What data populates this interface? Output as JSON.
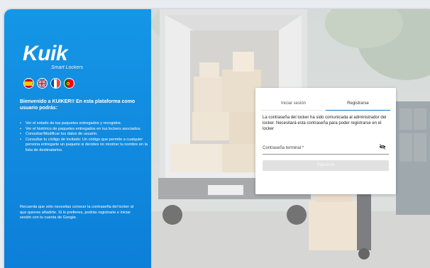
{
  "brand": {
    "name": "Kuik",
    "tagline": "Smart Lockers"
  },
  "languages": [
    {
      "name": "es-flag-icon",
      "colors": [
        "#c60b1e",
        "#ffc400",
        "#c60b1e"
      ]
    },
    {
      "name": "uk-flag-icon",
      "colors": [
        "#012169",
        "#ffffff",
        "#c8102e"
      ]
    },
    {
      "name": "fr-flag-icon",
      "colors": [
        "#0055a4",
        "#ffffff",
        "#ef4135"
      ]
    },
    {
      "name": "pt-flag-icon",
      "colors": [
        "#006600",
        "#ff0000",
        "#ffcc00"
      ]
    }
  ],
  "sidebar": {
    "welcome": "Bienvenido a KUIKER!! En esta plataforma como usuario podrás:",
    "features": [
      "Ver el estado de tus paquetes entregados y recogidos.",
      "Ver el histórico de paquetes entregados en tus lockers asociados.",
      "Consultar/Modificar tus datos de usuario.",
      "Consultar tu código de invitado: Un código que permite a cualquier persona entregarte un paquete si decides no mostrar tu nombre en la lista de destinatarios."
    ],
    "note": "Recuerda que sólo necesitas conocer la contraseña del locker al que quieres añadirte. Si lo prefieres, podrás registrarte e iniciar sesión con tu cuenta de Google."
  },
  "form": {
    "tab_login": "Iniciar sesión",
    "tab_register": "Registrarse",
    "active_tab": "Registrarse",
    "message": "La contraseña del locker ha sido comunicada al administrador del locker. Necesitará esta contraseña para poder registrarse en el locker",
    "password_label": "Contraseña terminal *",
    "password_value": "",
    "next_button": "Siguiente"
  },
  "colors": {
    "sidebar_blue": "#1596e6",
    "tab_underline": "#1778c4",
    "button_disabled": "#e1e1e1"
  }
}
